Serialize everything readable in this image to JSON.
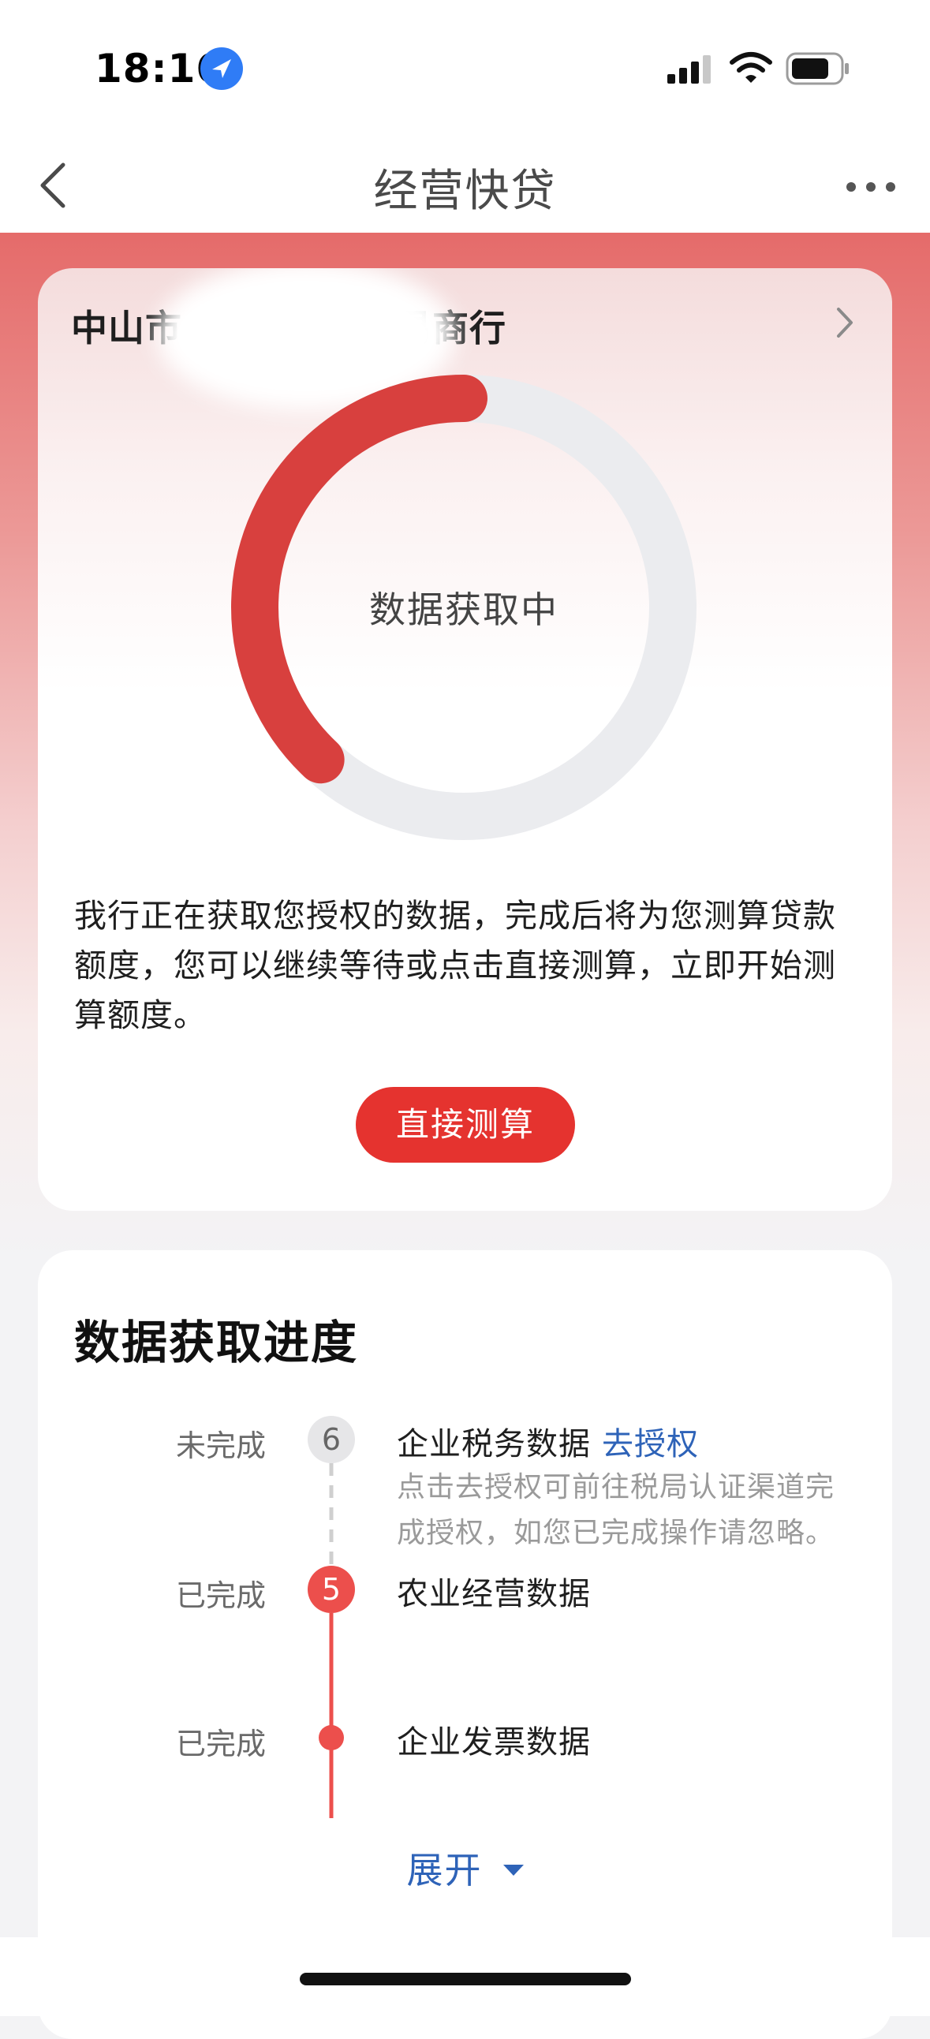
{
  "status_bar": {
    "time": "18:16",
    "location_icon": "location-arrow-icon",
    "signal_icon": "cellular-signal-icon",
    "wifi_icon": "wifi-icon",
    "battery_icon": "battery-icon"
  },
  "nav": {
    "title": "经营快贷",
    "back_icon": "chevron-left-icon",
    "more_icon": "more-dots-icon"
  },
  "card": {
    "company_prefix": "中山市",
    "company_suffix": "易商行",
    "status_label": "数据获取中",
    "progress_percent": 38,
    "description": "我行正在获取您授权的数据，完成后将为您测算贷款额度，您可以继续等待或点击直接测算，立即开始测算额度。",
    "button_label": "直接测算",
    "accent_color": "#e5332f"
  },
  "progress": {
    "title": "数据获取进度",
    "steps": [
      {
        "status": "未完成",
        "number": "6",
        "name": "企业税务数据",
        "link": "去授权",
        "desc": "点击去授权可前往税局认证渠道完成授权，如您已完成操作请忽略。"
      },
      {
        "status": "已完成",
        "number": "5",
        "name": "农业经营数据"
      },
      {
        "status": "已完成",
        "name": "企业发票数据"
      }
    ],
    "expand_label": "展开"
  }
}
